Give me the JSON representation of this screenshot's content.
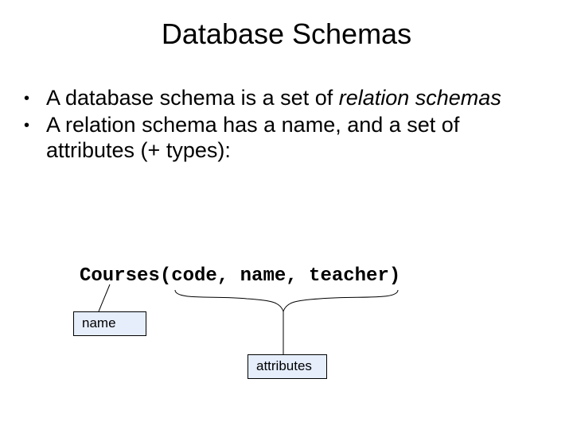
{
  "title": "Database Schemas",
  "bullets": [
    {
      "pre": "A database schema is a set of ",
      "em": "relation schemas",
      "post": ""
    },
    {
      "pre": "A relation schema has a name, and a set of attributes (+ types):",
      "em": "",
      "post": ""
    }
  ],
  "code": "Courses(code, name, teacher)",
  "callouts": {
    "name": "name",
    "attributes": "attributes"
  }
}
